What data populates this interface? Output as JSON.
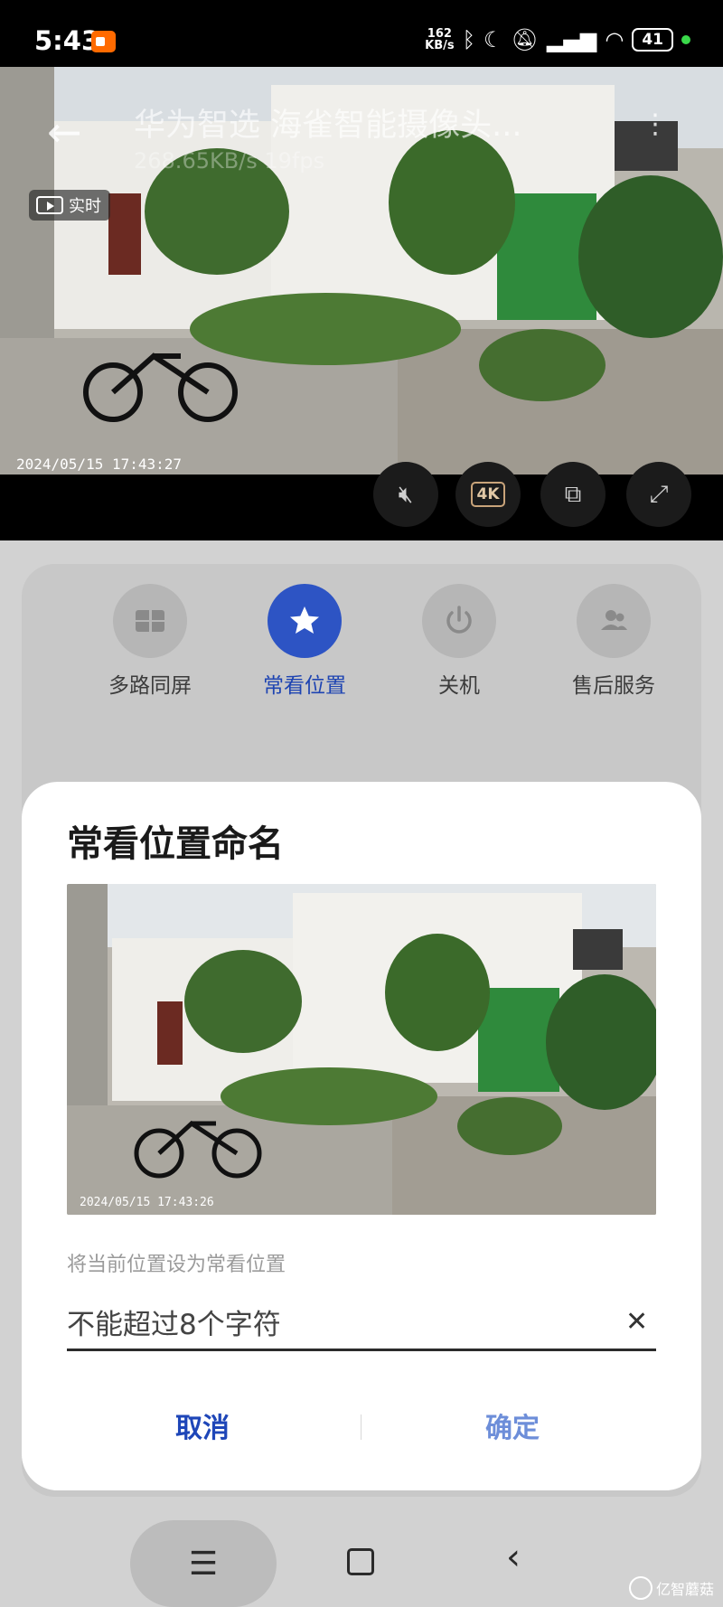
{
  "status_bar": {
    "time": "5:43",
    "net_speed_value": "162",
    "net_speed_unit": "KB/s",
    "battery": "41"
  },
  "video": {
    "title": "华为智选 海雀智能摄像头...",
    "stats": "268.65KB/s 19fps",
    "live_label": "实时",
    "timestamp": "2024/05/15 17:43:27",
    "quality": "4K"
  },
  "actions": [
    {
      "label": "多路同屏",
      "icon": "split-screen-icon"
    },
    {
      "label": "常看位置",
      "icon": "star-icon"
    },
    {
      "label": "关机",
      "icon": "power-icon"
    },
    {
      "label": "售后服务",
      "icon": "people-icon"
    }
  ],
  "dialog": {
    "title": "常看位置命名",
    "preview_timestamp": "2024/05/15 17:43:26",
    "subtitle": "将当前位置设为常看位置",
    "input_placeholder": "不能超过8个字符",
    "cancel_label": "取消",
    "confirm_label": "确定"
  },
  "watermark": "亿智蘑菇"
}
